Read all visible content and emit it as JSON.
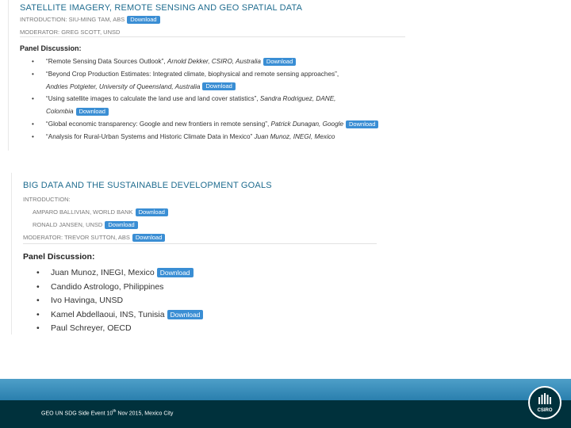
{
  "section1": {
    "title": "SATELLITE IMAGERY, REMOTE SENSING AND GEO SPATIAL DATA",
    "intro_label": "INTRODUCTION: SIU-MING TAM, ABS",
    "moderator": "MODERATOR: GREG SCOTT, UNSD",
    "panel_heading": "Panel Discussion:",
    "download_label": "Download",
    "items": [
      {
        "text": "“Remote Sensing Data Sources Outlook”, ",
        "italic": "Arnold Dekker, CSIRO, Australia",
        "download": true
      },
      {
        "text": "“Beyond Crop Production Estimates: Integrated climate, biophysical and remote sensing approaches”,",
        "italic": "",
        "download": false
      },
      {
        "text": "",
        "italic": "Andries Potgieter, University of Queensland, Australia",
        "download": true
      },
      {
        "text": "“Using satellite images to calculate the land use and land cover statistics”, ",
        "italic": "Sandra Rodriguez, DANE,",
        "download": false
      },
      {
        "text": "",
        "italic": "Colombia",
        "download": true
      },
      {
        "text": "“Global economic transparency: Google and new frontiers in remote sensing”, ",
        "italic": "Patrick Dunagan, Google",
        "download": true
      },
      {
        "text": "“Analysis for Rural-Urban Systems and Historic Climate Data in Mexico” ",
        "italic": "Juan Munoz, INEGI, Mexico",
        "download": false
      }
    ]
  },
  "section2": {
    "title": "BIG DATA AND THE SUSTAINABLE DEVELOPMENT GOALS",
    "intro_label": "INTRODUCTION:",
    "intro_speakers": [
      "AMPARO BALLIVIAN, WORLD BANK",
      "RONALD JANSEN, UNSD"
    ],
    "moderator": "MODERATOR: TREVOR SUTTON, ABS",
    "panel_heading": "Panel Discussion:",
    "download_label": "Download",
    "items": [
      {
        "text": "Juan Munoz, INEGI, Mexico",
        "download": true
      },
      {
        "text": "Candido Astrologo, Philippines",
        "download": false
      },
      {
        "text": "Ivo Havinga, UNSD",
        "download": false
      },
      {
        "text": "Kamel Abdellaoui, INS, Tunisia",
        "download": true
      },
      {
        "text": "Paul Schreyer, OECD",
        "download": false
      }
    ]
  },
  "footer": {
    "text_pre": "GEO UN SDG Side Event 10",
    "text_sup": "th",
    "text_post": " Nov 2015, Mexico City",
    "logo_text": "CSIRO"
  }
}
